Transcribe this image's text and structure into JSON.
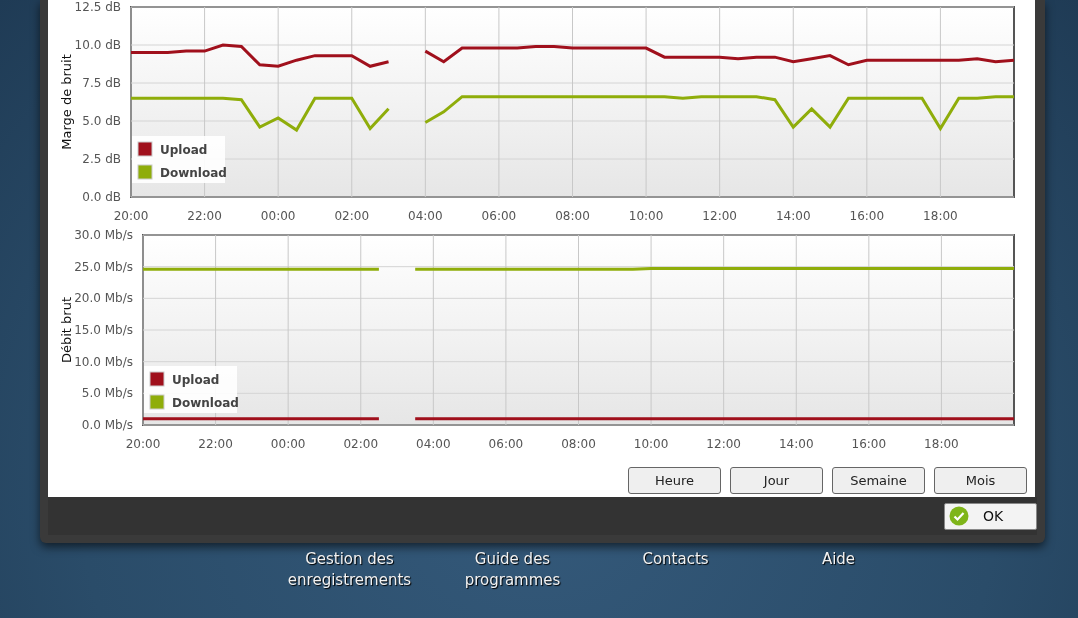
{
  "charts": [
    {
      "chart_data": {
        "type": "line",
        "ylabel": "Marge de bruit",
        "ylim": [
          0,
          12.5
        ],
        "grid": true,
        "legend": true,
        "categories": [
          "20:00",
          null,
          null,
          null,
          "22:00",
          null,
          null,
          null,
          "00:00",
          null,
          null,
          null,
          "02:00",
          null,
          null,
          null,
          "04:00",
          null,
          null,
          null,
          "06:00",
          null,
          null,
          null,
          "08:00",
          null,
          null,
          null,
          "10:00",
          null,
          null,
          null,
          "12:00",
          null,
          null,
          null,
          "14:00",
          null,
          null,
          null,
          "16:00",
          null,
          null,
          null,
          "18:00",
          null,
          null,
          null,
          null
        ],
        "yticks": [
          {
            "value": 0,
            "label": "0.0 dB"
          },
          {
            "value": 2.5,
            "label": "2.5 dB"
          },
          {
            "value": 5,
            "label": "5.0 dB"
          },
          {
            "value": 7.5,
            "label": "7.5 dB"
          },
          {
            "value": 10,
            "label": "10.0 dB"
          },
          {
            "value": 12.5,
            "label": "12.5 dB"
          }
        ],
        "series": [
          {
            "name": "Upload",
            "color": "#a0101c",
            "values": [
              9.5,
              9.5,
              9.5,
              9.6,
              9.6,
              10.0,
              9.9,
              8.7,
              8.6,
              9.0,
              9.3,
              9.3,
              9.3,
              8.6,
              8.9,
              null,
              9.6,
              8.9,
              9.8,
              9.8,
              9.8,
              9.8,
              9.9,
              9.9,
              9.8,
              9.8,
              9.8,
              9.8,
              9.8,
              9.2,
              9.2,
              9.2,
              9.2,
              9.1,
              9.2,
              9.2,
              8.9,
              9.1,
              9.3,
              8.7,
              9.0,
              9.0,
              9.0,
              9.0,
              9.0,
              9.0,
              9.1,
              8.9,
              9.0
            ]
          },
          {
            "name": "Download",
            "color": "#8fad0a",
            "values": [
              6.5,
              6.5,
              6.5,
              6.5,
              6.5,
              6.5,
              6.4,
              4.6,
              5.2,
              4.4,
              6.5,
              6.5,
              6.5,
              4.5,
              5.8,
              null,
              4.9,
              5.6,
              6.6,
              6.6,
              6.6,
              6.6,
              6.6,
              6.6,
              6.6,
              6.6,
              6.6,
              6.6,
              6.6,
              6.6,
              6.5,
              6.6,
              6.6,
              6.6,
              6.6,
              6.4,
              4.6,
              5.8,
              4.6,
              6.5,
              6.5,
              6.5,
              6.5,
              6.5,
              4.5,
              6.5,
              6.5,
              6.6,
              6.6
            ]
          }
        ]
      }
    },
    {
      "chart_data": {
        "type": "line",
        "ylabel": "Débit brut",
        "ylim": [
          0,
          30
        ],
        "grid": true,
        "legend": true,
        "categories": [
          "20:00",
          null,
          null,
          null,
          "22:00",
          null,
          null,
          null,
          "00:00",
          null,
          null,
          null,
          "02:00",
          null,
          null,
          null,
          "04:00",
          null,
          null,
          null,
          "06:00",
          null,
          null,
          null,
          "08:00",
          null,
          null,
          null,
          "10:00",
          null,
          null,
          null,
          "12:00",
          null,
          null,
          null,
          "14:00",
          null,
          null,
          null,
          "16:00",
          null,
          null,
          null,
          "18:00",
          null,
          null,
          null,
          null
        ],
        "yticks": [
          {
            "value": 0,
            "label": "0.0 Mb/s"
          },
          {
            "value": 5,
            "label": "5.0 Mb/s"
          },
          {
            "value": 10,
            "label": "10.0 Mb/s"
          },
          {
            "value": 15,
            "label": "15.0 Mb/s"
          },
          {
            "value": 20,
            "label": "20.0 Mb/s"
          },
          {
            "value": 25,
            "label": "25.0 Mb/s"
          },
          {
            "value": 30,
            "label": "30.0 Mb/s"
          }
        ],
        "series": [
          {
            "name": "Upload",
            "color": "#a0101c",
            "values": [
              1.0,
              1.0,
              1.0,
              1.0,
              1.0,
              1.0,
              1.0,
              1.0,
              1.0,
              1.0,
              1.0,
              1.0,
              1.0,
              1.0,
              null,
              1.0,
              1.0,
              1.0,
              1.0,
              1.0,
              1.0,
              1.0,
              1.0,
              1.0,
              1.0,
              1.0,
              1.0,
              1.0,
              1.0,
              1.0,
              1.0,
              1.0,
              1.0,
              1.0,
              1.0,
              1.0,
              1.0,
              1.0,
              1.0,
              1.0,
              1.0,
              1.0,
              1.0,
              1.0,
              1.0,
              1.0,
              1.0,
              1.0,
              1.0
            ]
          },
          {
            "name": "Download",
            "color": "#8fad0a",
            "values": [
              24.6,
              24.6,
              24.6,
              24.6,
              24.6,
              24.6,
              24.6,
              24.6,
              24.6,
              24.6,
              24.6,
              24.6,
              24.6,
              24.6,
              null,
              24.6,
              24.6,
              24.6,
              24.6,
              24.6,
              24.6,
              24.6,
              24.6,
              24.6,
              24.6,
              24.6,
              24.6,
              24.6,
              24.7,
              24.7,
              24.7,
              24.7,
              24.7,
              24.7,
              24.7,
              24.7,
              24.7,
              24.7,
              24.7,
              24.7,
              24.7,
              24.7,
              24.7,
              24.7,
              24.7,
              24.7,
              24.7,
              24.7,
              24.7
            ]
          }
        ]
      }
    }
  ],
  "range_buttons": [
    {
      "label": "Heure"
    },
    {
      "label": "Jour"
    },
    {
      "label": "Semaine"
    },
    {
      "label": "Mois"
    }
  ],
  "ok_button": {
    "label": "OK"
  },
  "nav": [
    {
      "label": "Gestion des enregistrements"
    },
    {
      "label": "Guide des programmes"
    },
    {
      "label": "Contacts"
    },
    {
      "label": "Aide"
    }
  ]
}
